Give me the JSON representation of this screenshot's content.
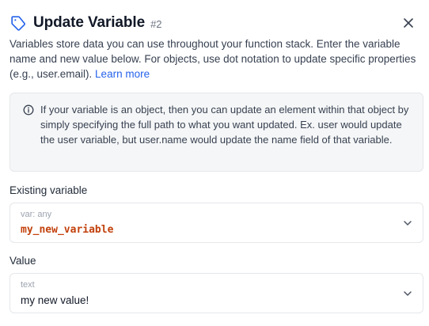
{
  "header": {
    "title": "Update Variable",
    "step": "#2"
  },
  "description": {
    "text": "Variables store data you can use throughout your function stack. Enter the variable name and new value below. For objects, use dot notation to update specific properties (e.g., user.email). ",
    "link": "Learn more"
  },
  "callout": {
    "text": "If your variable is an object, then you can update an element within that object by simply specifying the full path to what you want updated. Ex. user would update the user variable, but user.name would update the name field of that variable."
  },
  "existing_variable": {
    "label": "Existing variable",
    "type_hint": "var: any",
    "value": "my_new_variable"
  },
  "value_field": {
    "label": "Value",
    "type_hint": "text",
    "value": "my new value!"
  },
  "colors": {
    "accent": "#2563eb",
    "variable": "#c2410c",
    "muted": "#9ca3af"
  },
  "icons": [
    "tag-icon",
    "close-icon",
    "info-icon",
    "chevron-down-icon"
  ]
}
